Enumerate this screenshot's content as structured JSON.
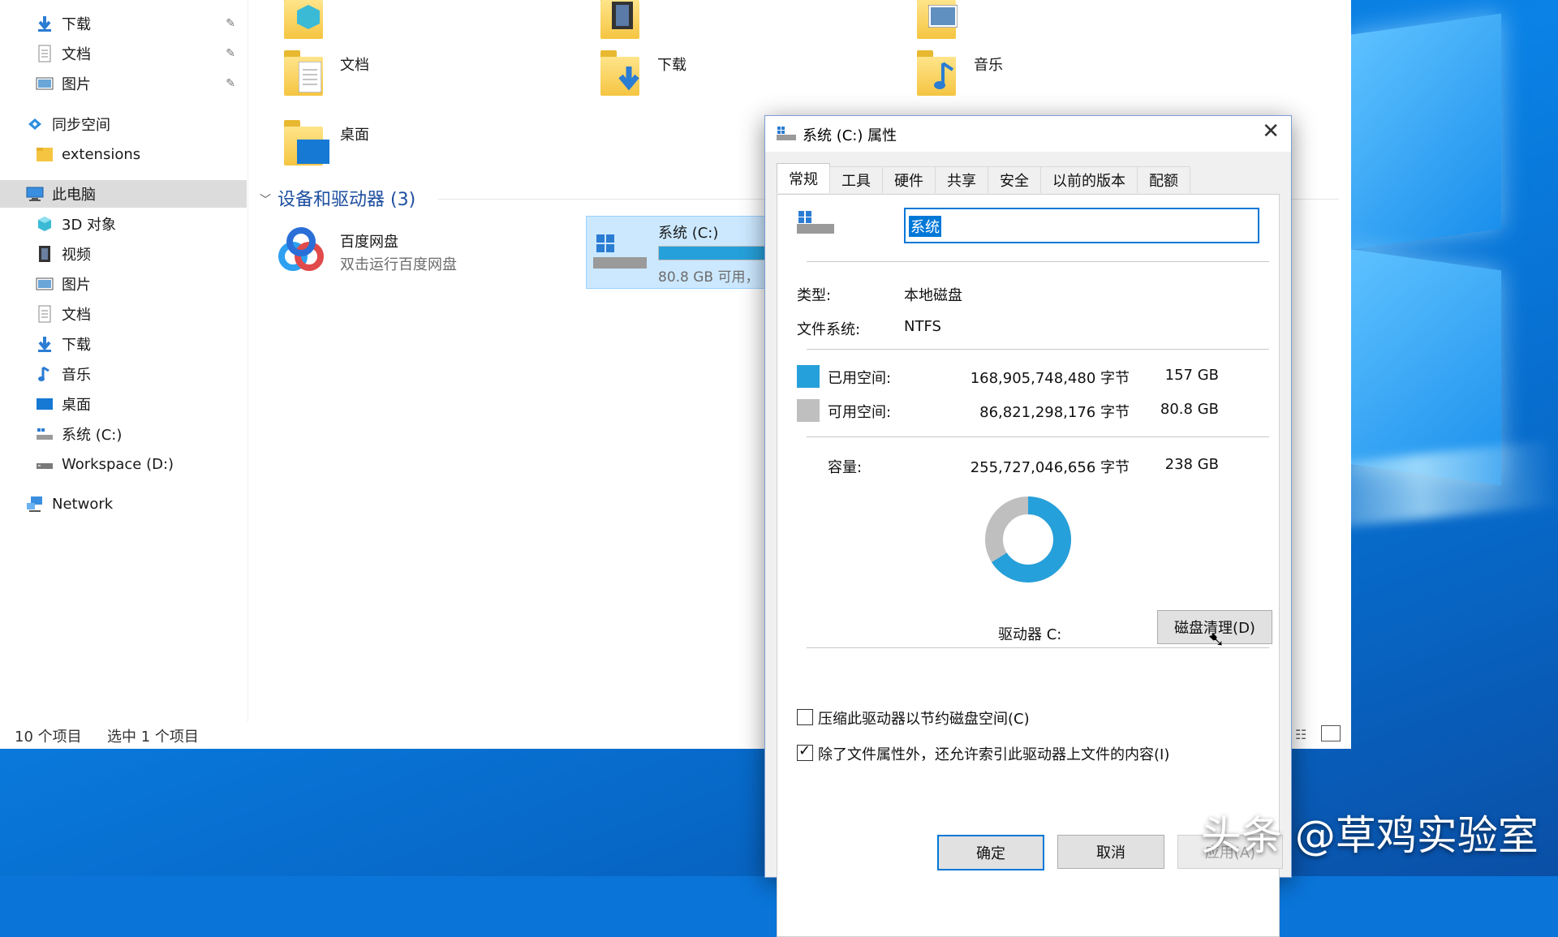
{
  "nav": {
    "items": [
      {
        "label": "下载",
        "pinned": true
      },
      {
        "label": "文档",
        "pinned": true
      },
      {
        "label": "图片",
        "pinned": true
      },
      {
        "label": "同步空间"
      },
      {
        "label": "extensions"
      },
      {
        "label": "此电脑",
        "selected": true
      },
      {
        "label": "3D 对象"
      },
      {
        "label": "视频"
      },
      {
        "label": "图片"
      },
      {
        "label": "文档"
      },
      {
        "label": "下载"
      },
      {
        "label": "音乐"
      },
      {
        "label": "桌面"
      },
      {
        "label": "系统 (C:)"
      },
      {
        "label": "Workspace (D:)"
      },
      {
        "label": "Network"
      }
    ]
  },
  "folders": {
    "documents": "文档",
    "downloads": "下载",
    "music": "音乐",
    "desktop": "桌面"
  },
  "devices": {
    "section_title": "设备和驱动器 (3)",
    "baidu": {
      "name": "百度网盘",
      "sub": "双击运行百度网盘"
    },
    "drive_c": {
      "name": "系统 (C:)",
      "free_text": "80.8 GB 可用，"
    }
  },
  "statusbar": {
    "count": "10 个项目",
    "selected": "选中 1 个项目"
  },
  "dialog": {
    "title": "系统 (C:) 属性",
    "tabs": [
      "常规",
      "工具",
      "硬件",
      "共享",
      "安全",
      "以前的版本",
      "配额"
    ],
    "name_value": "系统",
    "type_label": "类型:",
    "type_value": "本地磁盘",
    "fs_label": "文件系统:",
    "fs_value": "NTFS",
    "used_label": "已用空间:",
    "used_bytes": "168,905,748,480 字节",
    "used_size": "157 GB",
    "free_label": "可用空间:",
    "free_bytes": "86,821,298,176 字节",
    "free_size": "80.8 GB",
    "cap_label": "容量:",
    "cap_bytes": "255,727,046,656 字节",
    "cap_size": "238 GB",
    "drive_label": "驱动器 C:",
    "cleanup_button": "磁盘清理(D)",
    "compress_label": "压缩此驱动器以节约磁盘空间(C)",
    "compress_checked": false,
    "index_label": "除了文件属性外，还允许索引此驱动器上文件的内容(I)",
    "index_checked": true,
    "ok": "确定",
    "cancel": "取消",
    "apply": "应用(A)",
    "used_color": "#26a0da",
    "free_color": "#bfbfbf",
    "used_fraction": 0.66
  },
  "watermark": "头条 @草鸡实验室"
}
